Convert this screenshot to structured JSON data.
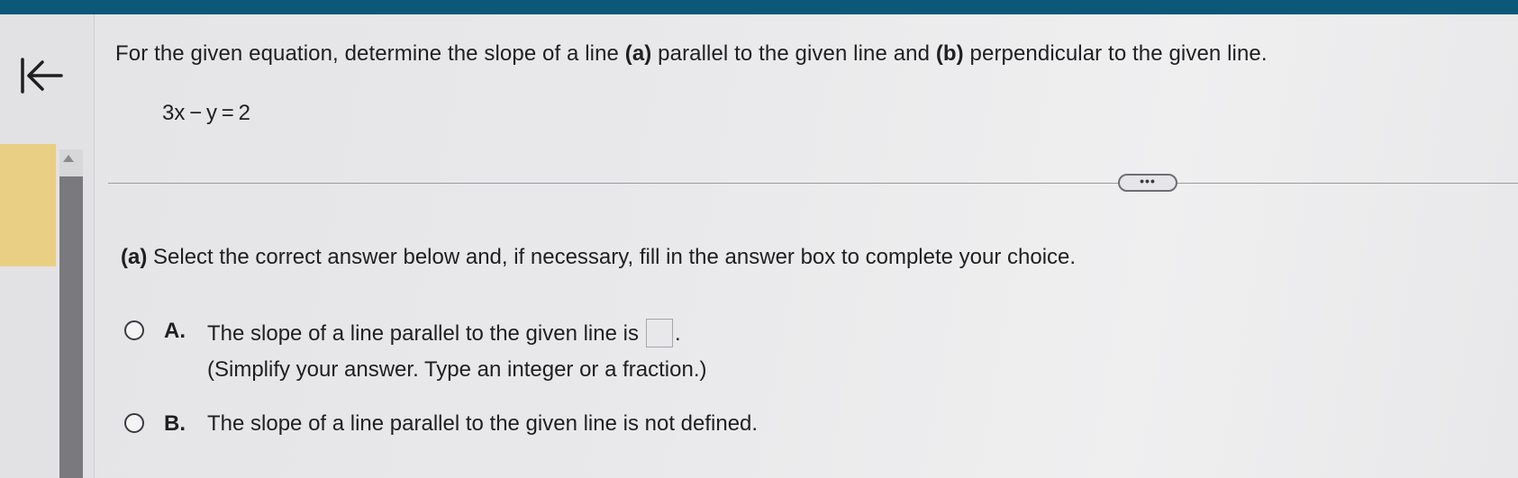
{
  "question": {
    "prefix": "For the given equation, determine the slope of a line ",
    "a_marker": "(a)",
    "middle": " parallel to the given line and ",
    "b_marker": "(b)",
    "suffix": " perpendicular to the given line."
  },
  "equation": "3x − y = 2",
  "more_button_label": "•••",
  "part_a": {
    "marker": "(a)",
    "instruction": " Select the correct answer below and, if necessary, fill in the answer box to complete your choice."
  },
  "choices": [
    {
      "letter": "A.",
      "text": "The slope of a line parallel to the given line is",
      "after_box": ".",
      "hint": "(Simplify your answer. Type an integer or a fraction.)",
      "answer_value": ""
    },
    {
      "letter": "B.",
      "text": "The slope of a line parallel to the given line is not defined."
    }
  ],
  "icons": {
    "back": "back-to-start-icon",
    "scroll_up": "scroll-up-arrow-icon"
  },
  "colors": {
    "top_bar": "#0c5878",
    "side_tab": "#e9cf84",
    "scroll_thumb": "#7a7a7e"
  }
}
